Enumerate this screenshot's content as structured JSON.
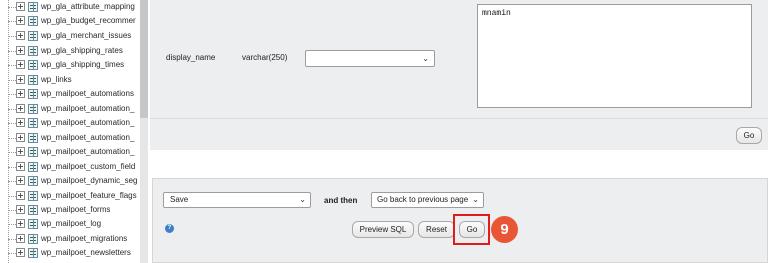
{
  "sidebar": {
    "items": [
      {
        "label": "wp_gla_attribute_mapping"
      },
      {
        "label": "wp_gla_budget_recommer"
      },
      {
        "label": "wp_gla_merchant_issues"
      },
      {
        "label": "wp_gla_shipping_rates"
      },
      {
        "label": "wp_gla_shipping_times"
      },
      {
        "label": "wp_links"
      },
      {
        "label": "wp_mailpoet_automations"
      },
      {
        "label": "wp_mailpoet_automation_"
      },
      {
        "label": "wp_mailpoet_automation_"
      },
      {
        "label": "wp_mailpoet_automation_"
      },
      {
        "label": "wp_mailpoet_automation_"
      },
      {
        "label": "wp_mailpoet_custom_field"
      },
      {
        "label": "wp_mailpoet_dynamic_seg"
      },
      {
        "label": "wp_mailpoet_feature_flags"
      },
      {
        "label": "wp_mailpoet_forms"
      },
      {
        "label": "wp_mailpoet_log"
      },
      {
        "label": "wp_mailpoet_migrations"
      },
      {
        "label": "wp_mailpoet_newsletters"
      }
    ]
  },
  "field": {
    "name": "display_name",
    "type": "varchar(250)",
    "function_value": "",
    "value": "mnamin"
  },
  "go_top_label": "Go",
  "action": {
    "save_value": "Save",
    "and_then_label": "and then",
    "after_value": "Go back to previous page",
    "help_icon_glyph": "?",
    "preview_sql_label": "Preview SQL",
    "reset_label": "Reset",
    "go_label": "Go"
  },
  "annotation": {
    "step_number": "9",
    "highlight_color": "#e21b1b",
    "badge_color": "#e85636"
  },
  "icons": {
    "expander": "plus-box-icon",
    "table": "table-icon",
    "chevron": "chevron-down-icon",
    "help": "help-icon"
  }
}
